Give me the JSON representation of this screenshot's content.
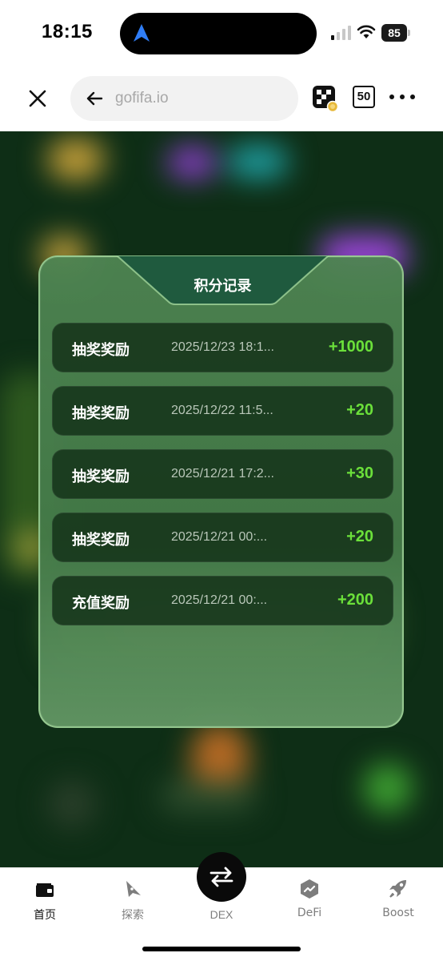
{
  "status_bar": {
    "time": "18:15",
    "battery": "85"
  },
  "browser": {
    "url": "gofifa.io",
    "tab_count": "50"
  },
  "modal": {
    "title": "积分记录",
    "records": [
      {
        "type": "抽奖奖励",
        "time": "2025/12/23 18:1...",
        "points": "+1000"
      },
      {
        "type": "抽奖奖励",
        "time": "2025/12/22 11:5...",
        "points": "+20"
      },
      {
        "type": "抽奖奖励",
        "time": "2025/12/21 17:2...",
        "points": "+30"
      },
      {
        "type": "抽奖奖励",
        "time": "2025/12/21 00:...",
        "points": "+20"
      },
      {
        "type": "充值奖励",
        "time": "2025/12/21 00:...",
        "points": "+200"
      }
    ]
  },
  "bottom_nav": {
    "items": [
      {
        "label": "首页",
        "icon": "wallet-icon",
        "active": true
      },
      {
        "label": "探索",
        "icon": "compass-icon",
        "active": false
      },
      {
        "label": "DEX",
        "icon": "swap-icon",
        "active": false
      },
      {
        "label": "DeFi",
        "icon": "defi-icon",
        "active": false
      },
      {
        "label": "Boost",
        "icon": "rocket-icon",
        "active": false
      }
    ]
  },
  "colors": {
    "points_green": "#6be03a",
    "modal_green": "#4e8452",
    "record_bg": "#16341a"
  }
}
